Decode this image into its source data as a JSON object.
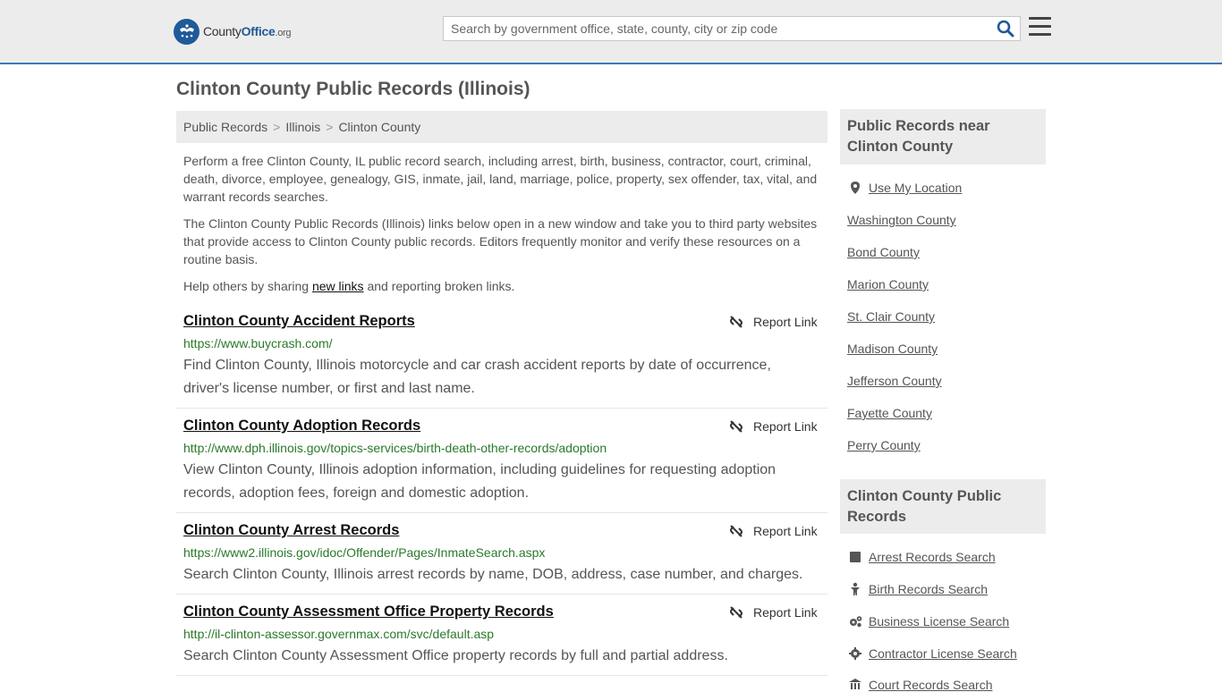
{
  "header": {
    "logo": {
      "county": "County",
      "office": "Office",
      "org": ".org"
    },
    "search_placeholder": "Search by government office, state, county, city or zip code"
  },
  "page_title": "Clinton County Public Records (Illinois)",
  "breadcrumb": [
    "Public Records",
    "Illinois",
    "Clinton County"
  ],
  "intro": {
    "p1": "Perform a free Clinton County, IL public record search, including arrest, birth, business, contractor, court, criminal, death, divorce, employee, genealogy, GIS, inmate, jail, land, marriage, police, property, sex offender, tax, vital, and warrant records searches.",
    "p2": "The Clinton County Public Records (Illinois) links below open in a new window and take you to third party websites that provide access to Clinton County public records. Editors frequently monitor and verify these resources on a routine basis.",
    "p3_before": "Help others by sharing ",
    "p3_link": "new links",
    "p3_after": " and reporting broken links."
  },
  "report_label": "Report Link",
  "entries": [
    {
      "title": "Clinton County Accident Reports",
      "url": "https://www.buycrash.com/",
      "desc": "Find Clinton County, Illinois motorcycle and car crash accident reports by date of occurrence, driver's license number, or first and last name."
    },
    {
      "title": "Clinton County Adoption Records",
      "url": "http://www.dph.illinois.gov/topics-services/birth-death-other-records/adoption",
      "desc": "View Clinton County, Illinois adoption information, including guidelines for requesting adoption records, adoption fees, foreign and domestic adoption."
    },
    {
      "title": "Clinton County Arrest Records",
      "url": "https://www2.illinois.gov/idoc/Offender/Pages/InmateSearch.aspx",
      "desc": "Search Clinton County, Illinois arrest records by name, DOB, address, case number, and charges."
    },
    {
      "title": "Clinton County Assessment Office Property Records",
      "url": "http://il-clinton-assessor.governmax.com/svc/default.asp",
      "desc": "Search Clinton County Assessment Office property records by full and partial address."
    }
  ],
  "sidebar": {
    "near_title": "Public Records near Clinton County",
    "use_location": "Use My Location",
    "nearby": [
      "Washington County",
      "Bond County",
      "Marion County",
      "St. Clair County",
      "Madison County",
      "Jefferson County",
      "Fayette County",
      "Perry County"
    ],
    "records_title": "Clinton County Public Records",
    "records": [
      {
        "label": "Arrest Records Search",
        "icon": "arrest-icon"
      },
      {
        "label": "Birth Records Search",
        "icon": "baby-icon"
      },
      {
        "label": "Business License Search",
        "icon": "gears-icon"
      },
      {
        "label": "Contractor License Search",
        "icon": "gear-icon"
      },
      {
        "label": "Court Records Search",
        "icon": "courthouse-icon"
      }
    ]
  },
  "colors": {
    "accent": "#3f78b5",
    "url_green": "#2a7a2a",
    "bar_bg": "#ececec"
  }
}
